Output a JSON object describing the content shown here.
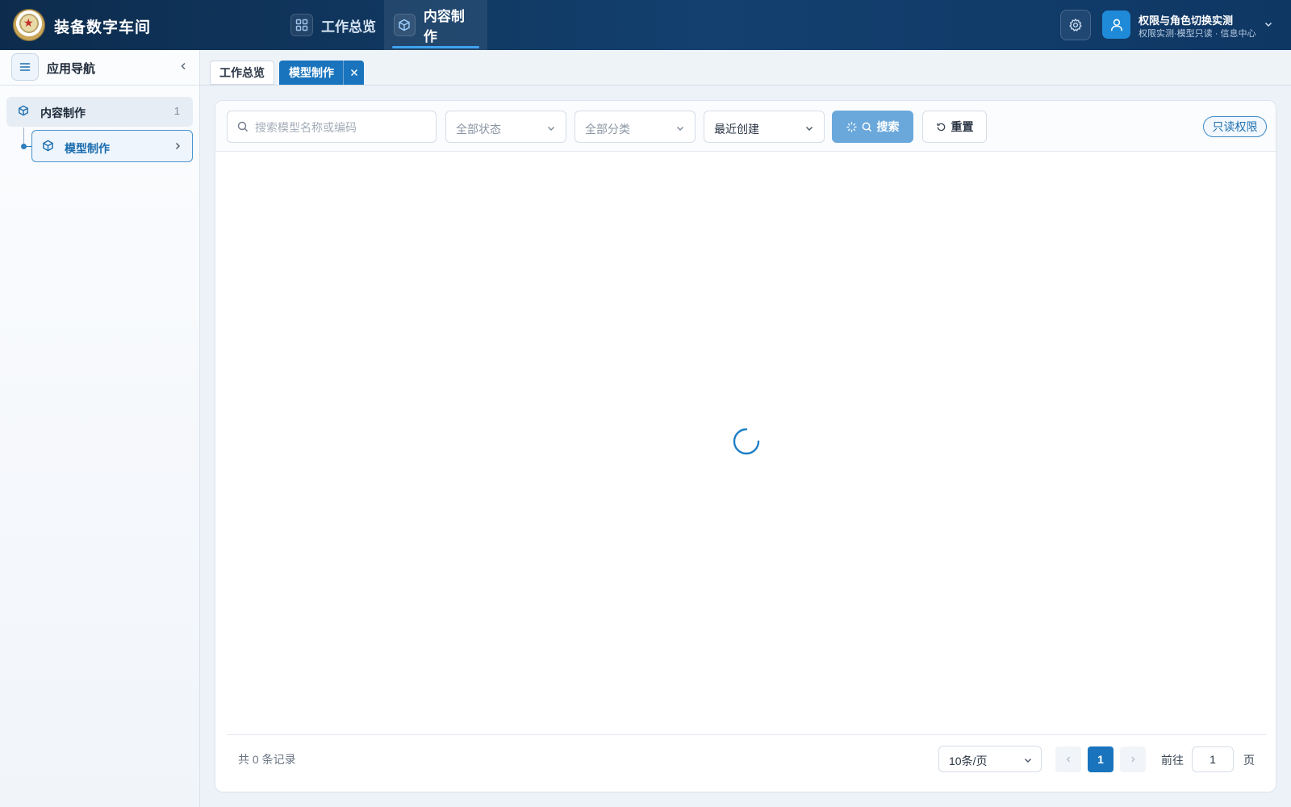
{
  "app": {
    "title": "装备数字车间"
  },
  "top_nav": [
    {
      "label": "工作总览",
      "icon": "grid-icon",
      "active": false
    },
    {
      "label": "内容制作",
      "icon": "cube-icon",
      "active": true
    }
  ],
  "user": {
    "name": "权限与角色切换实测",
    "subtitle": "权限实测·模型只读 · 信息中心"
  },
  "sidebar": {
    "title": "应用导航",
    "groups": [
      {
        "label": "内容制作",
        "count": "1",
        "items": [
          {
            "label": "模型制作",
            "active": true
          }
        ]
      }
    ]
  },
  "page_tabs": [
    {
      "label": "工作总览",
      "active": false,
      "closable": false
    },
    {
      "label": "模型制作",
      "active": true,
      "closable": true
    }
  ],
  "filters": {
    "search_placeholder": "搜索模型名称或编码",
    "status": "全部状态",
    "category": "全部分类",
    "sort": "最近创建",
    "search_button": "搜索",
    "reset_button": "重置",
    "permission_badge": "只读权限"
  },
  "table": {
    "loading": true,
    "rows": []
  },
  "pagination": {
    "total_text": "共 0 条记录",
    "page_size": "10条/页",
    "current_page": "1",
    "goto_prefix": "前往",
    "goto_value": "1",
    "goto_suffix": "页"
  },
  "colors": {
    "header_bg": "#0f3764",
    "accent": "#1a74bd",
    "search_button": "#6aa8dc"
  }
}
